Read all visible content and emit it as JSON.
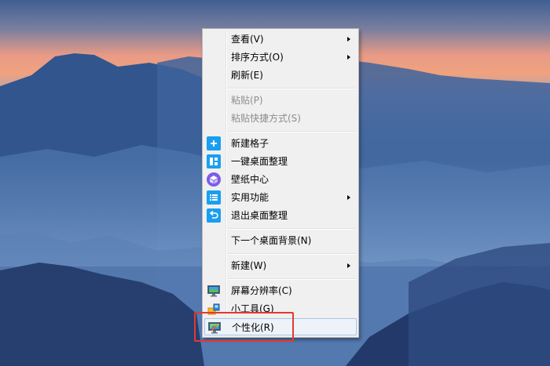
{
  "context_menu": {
    "items": [
      {
        "label": "查看(V)",
        "submenu": true
      },
      {
        "label": "排序方式(O)",
        "submenu": true
      },
      {
        "label": "刷新(E)"
      },
      {
        "label": "粘贴(P)",
        "disabled": true
      },
      {
        "label": "粘贴快捷方式(S)",
        "disabled": true
      },
      {
        "label": "新建格子",
        "icon": "plus-icon"
      },
      {
        "label": "一键桌面整理",
        "icon": "layout-grid-icon"
      },
      {
        "label": "壁纸中心",
        "icon": "cube-icon"
      },
      {
        "label": "实用功能",
        "icon": "list-icon",
        "submenu": true
      },
      {
        "label": "退出桌面整理",
        "icon": "exit-icon"
      },
      {
        "label": "下一个桌面背景(N)"
      },
      {
        "label": "新建(W)",
        "submenu": true
      },
      {
        "label": "屏幕分辨率(C)",
        "icon": "monitor-icon"
      },
      {
        "label": "小工具(G)",
        "icon": "gadgets-icon"
      },
      {
        "label": "个性化(R)",
        "icon": "personalize-icon",
        "highlighted": true
      }
    ]
  },
  "colors": {
    "accent_icon": "#1a9ff0",
    "highlight_box": "#e8372e",
    "menu_background": "#f0f0f0"
  }
}
